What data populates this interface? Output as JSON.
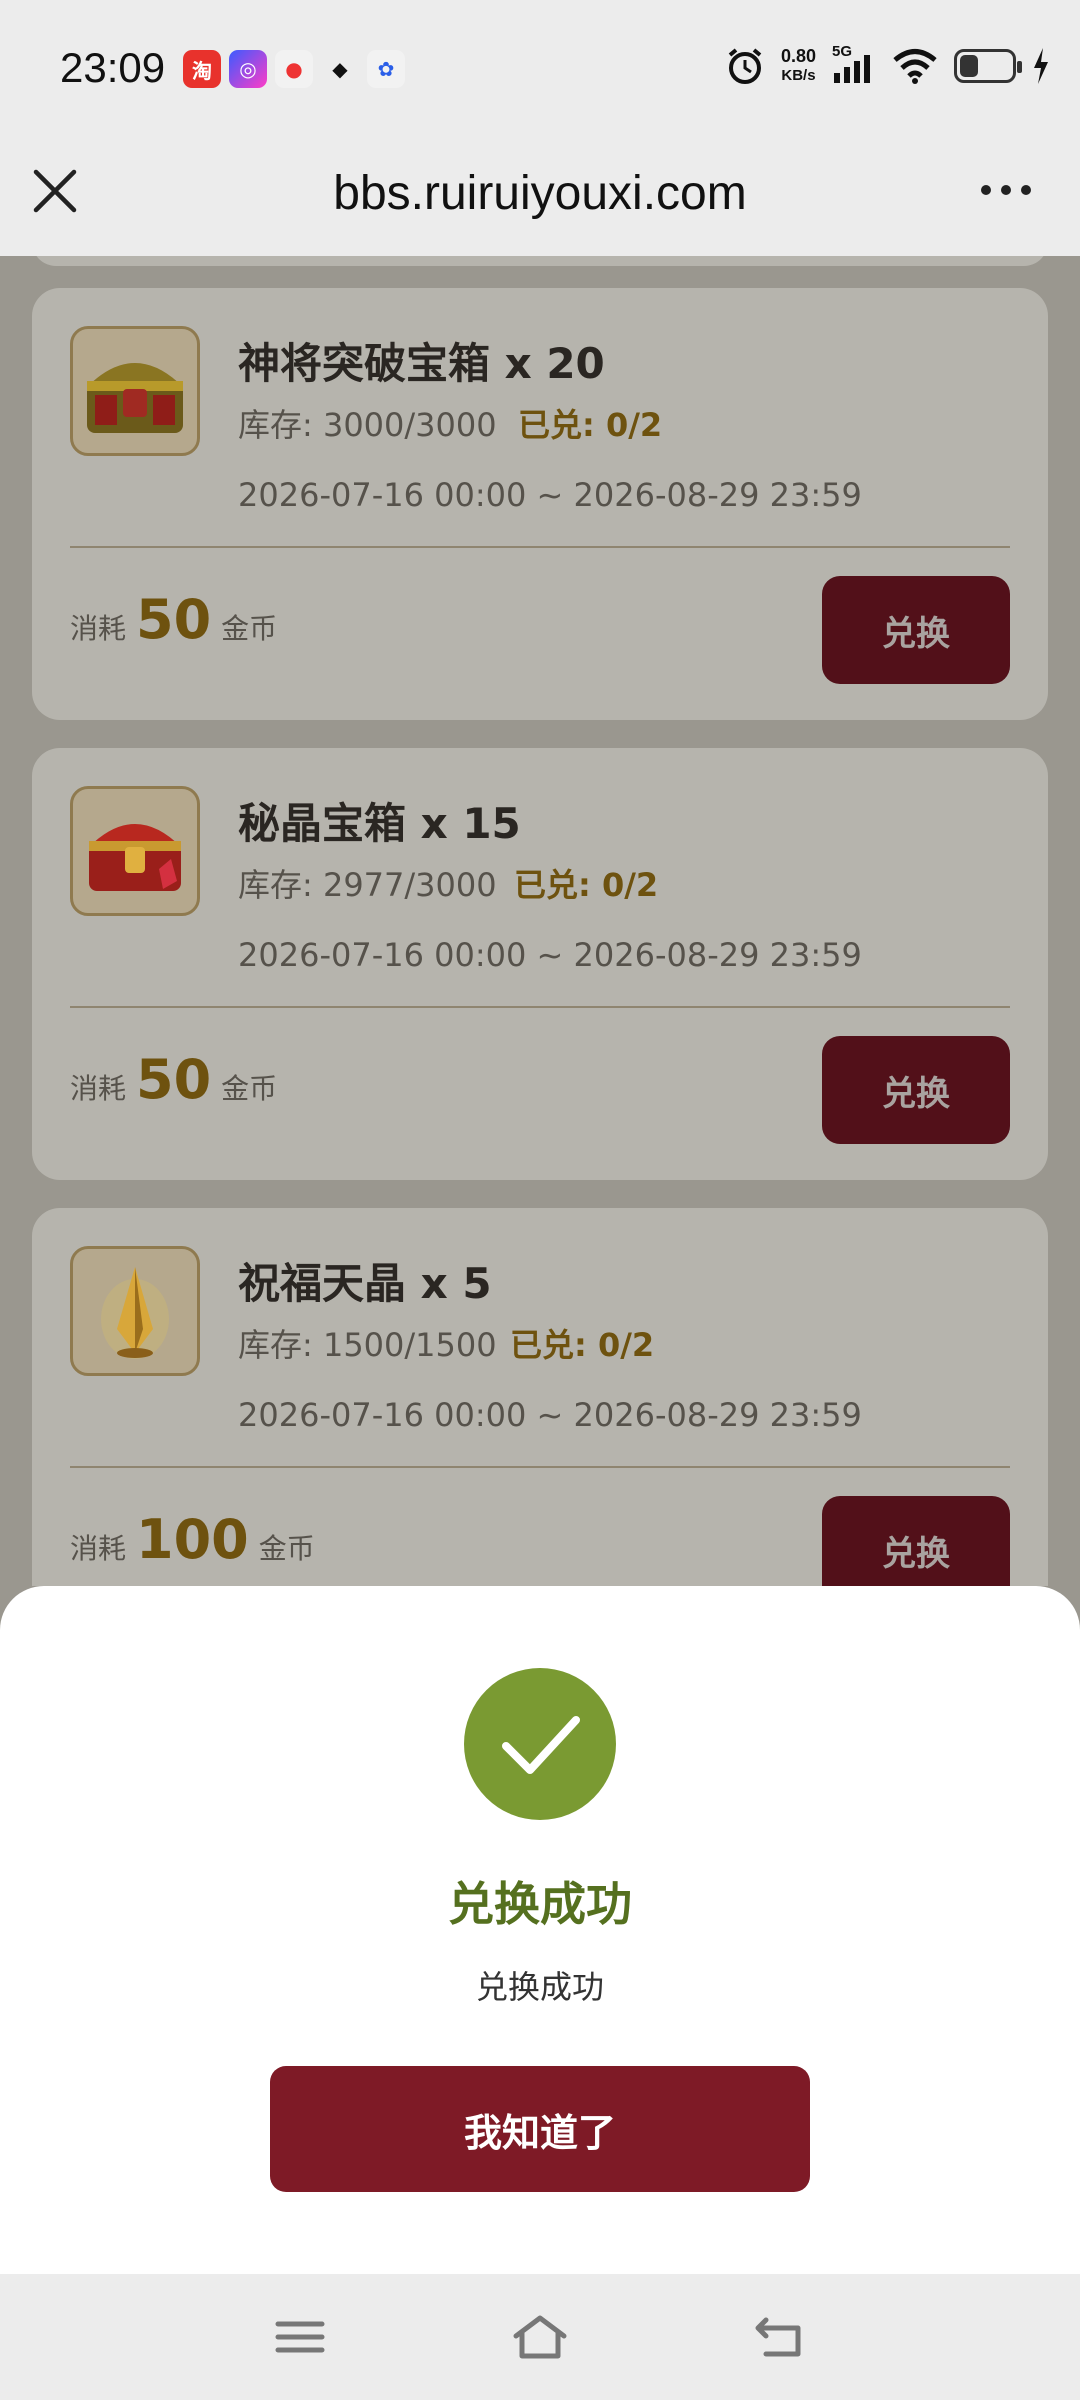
{
  "status_bar": {
    "time": "23:09",
    "net_speed": "0.80",
    "net_unit": "KB/s",
    "network": "5G",
    "battery_level": 0.35,
    "apps": [
      "taobao-icon",
      "app-icon",
      "douyin-icon",
      "qq-icon",
      "baidu-icon"
    ]
  },
  "header": {
    "title": "bbs.ruiruiyouxi.com",
    "close_icon": "close-icon",
    "more_icon": "more-icon"
  },
  "items": [
    {
      "title": "神将突破宝箱 x 20",
      "stock": "库存: 3000/3000",
      "redeemed": "已兑: 0/2",
      "period": "2026-07-16 00:00 ~ 2026-08-29 23:59",
      "cost_label": "消耗",
      "cost": "50",
      "cost_unit": "金币",
      "button": "兑换",
      "icon": "gold-chest-icon"
    },
    {
      "title": "秘晶宝箱 x 15",
      "stock": "库存: 2977/3000",
      "redeemed": "已兑: 0/2",
      "period": "2026-07-16 00:00 ~ 2026-08-29 23:59",
      "cost_label": "消耗",
      "cost": "50",
      "cost_unit": "金币",
      "button": "兑换",
      "icon": "red-chest-icon"
    },
    {
      "title": "祝福天晶 x 5",
      "stock": "库存: 1500/1500",
      "redeemed": "已兑: 0/2",
      "period": "2026-07-16 00:00 ~ 2026-08-29 23:59",
      "cost_label": "消耗",
      "cost": "100",
      "cost_unit": "金币",
      "button": "兑换",
      "icon": "crystal-icon"
    }
  ],
  "dialog": {
    "title": "兑换成功",
    "message": "兑换成功",
    "button": "我知道了",
    "success_color": "#7a9a32",
    "button_color": "#7e1a26"
  },
  "nav": {
    "menu_icon": "menu-icon",
    "home_icon": "home-icon",
    "back_icon": "back-icon"
  }
}
